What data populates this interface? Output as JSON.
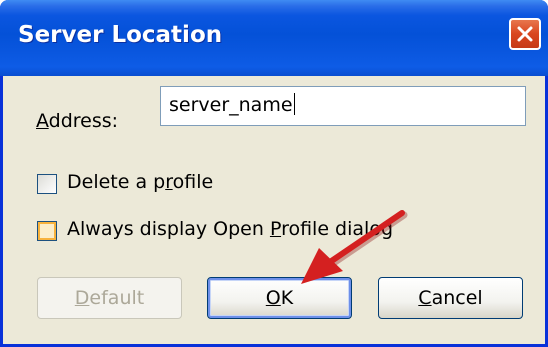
{
  "window": {
    "title": "Server Location"
  },
  "address": {
    "label_prefix": "",
    "label_mnemonic": "A",
    "label_rest": "ddress:",
    "value": "server_name"
  },
  "options": {
    "delete_profile": {
      "label_before": "Delete a p",
      "label_mnemonic": "r",
      "label_after": "ofile",
      "checked": false
    },
    "always_display": {
      "label_before": "Always display Open ",
      "label_mnemonic": "P",
      "label_after": "rofile dialog",
      "checked": false
    }
  },
  "buttons": {
    "default": {
      "mnemonic": "D",
      "rest": "efault",
      "enabled": false
    },
    "ok": {
      "mnemonic": "O",
      "rest": "K"
    },
    "cancel": {
      "mnemonic": "C",
      "rest": "ancel"
    }
  },
  "colors": {
    "titlebar": "#0451d8",
    "dialog_face": "#ece9d8",
    "close_button": "#d9461f",
    "arrow": "#d42020"
  },
  "icons": {
    "close": "close-icon",
    "annotation": "red-arrow-icon"
  }
}
